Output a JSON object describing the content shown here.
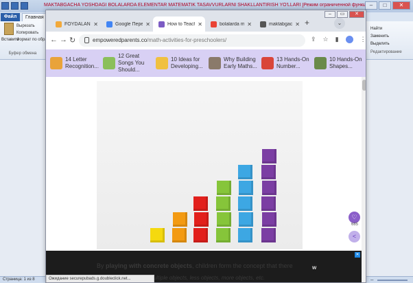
{
  "word": {
    "title": "MAKTABGACHA YOSHDAGI BOLALARDA ELEMENTAR MATEMATIK TASAVVURLARNI SHAKLLANTIRISH YO'LLARI [Режим ограниченной функциональности] - Microsoft Word (Сбой активации продукта)",
    "file_tab": "Файл",
    "home_tab": "Главная",
    "clipboard": {
      "paste": "Вставить",
      "cut": "Вырезать",
      "copy": "Копировать",
      "format": "Формат по образцу",
      "group": "Буфер обмена"
    },
    "editing": {
      "find": "Найти",
      "replace": "Заменить",
      "select": "Выделить",
      "group": "Редактирование"
    },
    "status_page": "Страница: 1 из 8"
  },
  "chrome": {
    "tabs": [
      {
        "title": "FOYDALANILGAN",
        "favicon_color": "#f2a93b",
        "active": false
      },
      {
        "title": "Google Переводчик",
        "favicon_color": "#4285f4",
        "active": false
      },
      {
        "title": "How to Teach Math",
        "favicon_color": "#7c5cc4",
        "active": true
      },
      {
        "title": "bolalarda matematik",
        "favicon_color": "#ea4335",
        "active": false
      },
      {
        "title": "maktabgacha-ta-lim",
        "favicon_color": "#555555",
        "active": false
      }
    ],
    "url_domain": "empoweredparents.co",
    "url_path": "/math-activities-for-preschoolers/",
    "bookmarks": [
      {
        "label": "14 Letter Recognition...",
        "color": "#e9a33a"
      },
      {
        "label": "12 Great Songs You Should...",
        "color": "#8bbf5a"
      },
      {
        "label": "10 Ideas for Developing...",
        "color": "#f0c040"
      },
      {
        "label": "Why Building Early Maths...",
        "color": "#8a7a6a"
      },
      {
        "label": "13 Hands-On Number...",
        "color": "#d9453a"
      },
      {
        "label": "10 Hands-On Shapes...",
        "color": "#6a8a4a"
      }
    ],
    "article": {
      "ad_text_bold": "playing with concrete objects",
      "ad_text_pre": "By ",
      "ad_text_post": ", children form the concept that there",
      "ad_text_line2": "multiple objects, less objects, more objects, etc.",
      "fab_count": "685"
    },
    "status_bubble": "Ожидание securepubads.g.doubleclick.net...",
    "accent": "#7c5cc4"
  },
  "photo": {
    "description_colors": [
      "#f5d90f",
      "#f39a12",
      "#e2201c",
      "#86c53a",
      "#3da7e3",
      "#7b3ea3"
    ]
  }
}
